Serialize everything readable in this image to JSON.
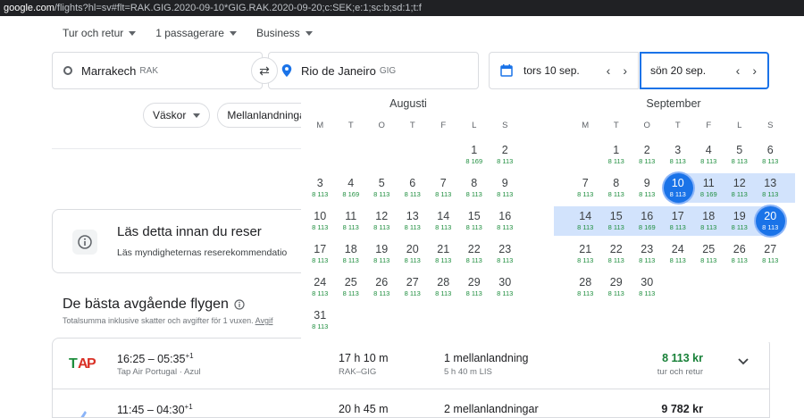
{
  "browser": {
    "url_host": "google.com",
    "url_rest": "/flights?hl=sv#flt=RAK.GIG.2020-09-10*GIG.RAK.2020-09-20;c:SEK;e:1;sc:b;sd:1;t:f"
  },
  "options": {
    "trip_type": "Tur och retur",
    "passengers": "1 passagerare",
    "cabin": "Business"
  },
  "search": {
    "from_city": "Marrakech",
    "from_code": "RAK",
    "to_city": "Rio de Janeiro",
    "to_code": "GIG",
    "departure_date": "tors 10 sep.",
    "return_date": "sön 20 sep."
  },
  "filters": {
    "bags": "Väskor",
    "stops": "Mellanlandninga"
  },
  "notice": {
    "title": "Läs detta innan du reser",
    "text": "Läs myndigheternas reserekommendatio"
  },
  "best_flights": {
    "title": "De bästa avgående flygen",
    "subtitle": "Totalsumma inklusive skatter och avgifter för 1 vuxen.",
    "subtitle_link": "Avgif"
  },
  "calendar": {
    "weekdays": [
      "M",
      "T",
      "O",
      "T",
      "F",
      "L",
      "S"
    ],
    "months": [
      {
        "name": "Augusti",
        "weeks": [
          [
            null,
            null,
            null,
            null,
            null,
            {
              "d": "1",
              "p": "8 169"
            },
            {
              "d": "2",
              "p": "8 113"
            }
          ],
          [
            {
              "d": "3",
              "p": "8 113"
            },
            {
              "d": "4",
              "p": "8 169"
            },
            {
              "d": "5",
              "p": "8 113"
            },
            {
              "d": "6",
              "p": "8 113"
            },
            {
              "d": "7",
              "p": "8 113"
            },
            {
              "d": "8",
              "p": "8 113"
            },
            {
              "d": "9",
              "p": "8 113"
            }
          ],
          [
            {
              "d": "10",
              "p": "8 113"
            },
            {
              "d": "11",
              "p": "8 113"
            },
            {
              "d": "12",
              "p": "8 113"
            },
            {
              "d": "13",
              "p": "8 113"
            },
            {
              "d": "14",
              "p": "8 113"
            },
            {
              "d": "15",
              "p": "8 113"
            },
            {
              "d": "16",
              "p": "8 113"
            }
          ],
          [
            {
              "d": "17",
              "p": "8 113"
            },
            {
              "d": "18",
              "p": "8 113"
            },
            {
              "d": "19",
              "p": "8 113"
            },
            {
              "d": "20",
              "p": "8 113"
            },
            {
              "d": "21",
              "p": "8 113"
            },
            {
              "d": "22",
              "p": "8 113"
            },
            {
              "d": "23",
              "p": "8 113"
            }
          ],
          [
            {
              "d": "24",
              "p": "8 113"
            },
            {
              "d": "25",
              "p": "8 113"
            },
            {
              "d": "26",
              "p": "8 113"
            },
            {
              "d": "27",
              "p": "8 113"
            },
            {
              "d": "28",
              "p": "8 113"
            },
            {
              "d": "29",
              "p": "8 113"
            },
            {
              "d": "30",
              "p": "8 113"
            }
          ],
          [
            {
              "d": "31",
              "p": "8 113"
            },
            null,
            null,
            null,
            null,
            null,
            null
          ]
        ]
      },
      {
        "name": "September",
        "weeks": [
          [
            null,
            {
              "d": "1",
              "p": "8 113"
            },
            {
              "d": "2",
              "p": "8 113"
            },
            {
              "d": "3",
              "p": "8 113"
            },
            {
              "d": "4",
              "p": "8 113"
            },
            {
              "d": "5",
              "p": "8 113"
            },
            {
              "d": "6",
              "p": "8 113"
            }
          ],
          [
            {
              "d": "7",
              "p": "8 113"
            },
            {
              "d": "8",
              "p": "8 113"
            },
            {
              "d": "9",
              "p": "8 113"
            },
            {
              "d": "10",
              "p": "8 113",
              "sel": true
            },
            {
              "d": "11",
              "p": "8 169"
            },
            {
              "d": "12",
              "p": "8 113"
            },
            {
              "d": "13",
              "p": "8 113"
            }
          ],
          [
            {
              "d": "14",
              "p": "8 113"
            },
            {
              "d": "15",
              "p": "8 113"
            },
            {
              "d": "16",
              "p": "8 169"
            },
            {
              "d": "17",
              "p": "8 113"
            },
            {
              "d": "18",
              "p": "8 113"
            },
            {
              "d": "19",
              "p": "8 113"
            },
            {
              "d": "20",
              "p": "8 113",
              "sel": true
            }
          ],
          [
            {
              "d": "21",
              "p": "8 113"
            },
            {
              "d": "22",
              "p": "8 113"
            },
            {
              "d": "23",
              "p": "8 113"
            },
            {
              "d": "24",
              "p": "8 113"
            },
            {
              "d": "25",
              "p": "8 113"
            },
            {
              "d": "26",
              "p": "8 113"
            },
            {
              "d": "27",
              "p": "8 113"
            }
          ],
          [
            {
              "d": "28",
              "p": "8 113"
            },
            {
              "d": "29",
              "p": "8 113"
            },
            {
              "d": "30",
              "p": "8 113"
            },
            null,
            null,
            null,
            null
          ]
        ]
      }
    ]
  },
  "flights": [
    {
      "times": "16:25 – 05:35",
      "plus": "+1",
      "airline": "Tap Air Portugal · Azul",
      "duration": "17 h 10 m",
      "route": "RAK–GIG",
      "stops": "1 mellanlandning",
      "stops_detail": "5 h 40 m LIS",
      "price": "8 113 kr",
      "price_type": "tur och retur",
      "logo": "tap-logo"
    },
    {
      "times": "11:45 – 04:30",
      "plus": "+1",
      "airline": "",
      "duration": "20 h 45 m",
      "route": "",
      "stops": "2 mellanlandningar",
      "stops_detail": "",
      "price": "9 782 kr",
      "price_type": "",
      "logo": "airline-logo"
    }
  ],
  "colors": {
    "accent": "#1a73e8",
    "range": "#d2e3fc",
    "price_green": "#1e8e3e"
  }
}
